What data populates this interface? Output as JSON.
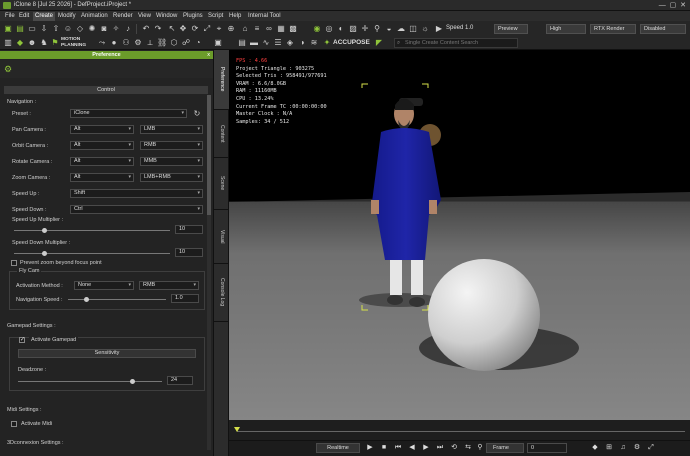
{
  "window": {
    "title": "iClone 8 [Jul 25 2026] - DefProject.iProject *"
  },
  "menu": [
    "File",
    "Edit",
    "Create",
    "Modify",
    "Animation",
    "Render",
    "View",
    "Window",
    "Plugins",
    "Script",
    "Help",
    "Internal Tool"
  ],
  "menu_active": "Create",
  "toolbar": {
    "motion_planning_label": "MOTION PLANNING",
    "speed_label": "Speed",
    "speed_value": "1.0",
    "preview_label": "Preview",
    "quality_label": "High",
    "renderer_label": "RTX Render",
    "denoise_label": "Disabled",
    "accupose_label": "ACCUPOSE",
    "search_placeholder": "Single Create Content Search"
  },
  "preference": {
    "title": "Preference",
    "close": "x",
    "control_header": "Control",
    "navigation_label": "Navigation :",
    "rows": [
      {
        "label": "Preset :",
        "value": "iClone",
        "value2": ""
      },
      {
        "label": "Pan Camera :",
        "value": "Alt",
        "value2": "LMB"
      },
      {
        "label": "Orbit Camera :",
        "value": "Alt",
        "value2": "RMB"
      },
      {
        "label": "Rotate Camera :",
        "value": "Alt",
        "value2": "MMB"
      },
      {
        "label": "Zoom Camera :",
        "value": "Alt",
        "value2": "LMB+RMB"
      },
      {
        "label": "Speed Up :",
        "value": "Shift",
        "value2": ""
      },
      {
        "label": "Speed Down :",
        "value": "Ctrl",
        "value2": ""
      }
    ],
    "speed_up_mult_label": "Speed Up Multiplier :",
    "speed_up_mult_value": "10",
    "speed_up_mult_level": 0.05,
    "speed_down_mult_label": "Speed Down Multiplier :",
    "speed_down_mult_value": "10",
    "prevent_zoom_label": "Prevent zoom beyond focus point",
    "fly_cam_label": "Fly Cam",
    "activation_label": "Activation Method :",
    "activation_value": "None",
    "activation_value2": "RMB",
    "nav_speed_label": "Navigation Speed :",
    "nav_speed_value": "1.0",
    "gamepad_settings_label": "Gamepad Settings :",
    "activate_gamepad_label": "Activate Gamepad",
    "sensitivity_label": "Sensitivity",
    "deadzone_label": "Deadzone :",
    "deadzone_value": "24",
    "midi_settings_label": "Midi Settings :",
    "activate_midi_label": "Activate Midi",
    "connexion_label": "3Dconnexion Settings :"
  },
  "side_tabs": [
    "Preference",
    "Content",
    "Scene",
    "Visual",
    "Console Log"
  ],
  "hud": {
    "fps": "FPS : 4.66",
    "lines": [
      "Project Triangle : 903275",
      "Selected Tris : 958491/977691",
      "VRAM : 6.6/8.0GB",
      "RAM : 11160MB",
      "CPU : 13.24%",
      "Current Frame TC :00:00:00:00",
      "Master Clock : N/A",
      "Samples: 34 / 512"
    ]
  },
  "bottom": {
    "realtime_label": "Realtime",
    "frame_label": "Frame",
    "frame_value": "0"
  },
  "colors": {
    "accent": "#6b9c2a",
    "hud_fps": "#ff4040",
    "robe": "#1f25a8"
  }
}
